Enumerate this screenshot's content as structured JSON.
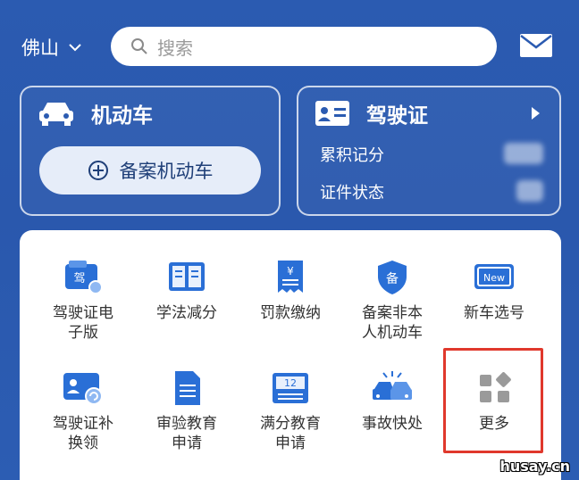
{
  "header": {
    "city": "佛山",
    "search_placeholder": "搜索"
  },
  "vehicle_card": {
    "title": "机动车",
    "register_button": "备案机动车"
  },
  "license_card": {
    "title": "驾驶证",
    "rows": [
      {
        "label": "累积记分"
      },
      {
        "label": "证件状态"
      }
    ]
  },
  "services": [
    {
      "label_line1": "驾驶证电",
      "label_line2": "子版",
      "icon": "e-license-icon"
    },
    {
      "label_line1": "学法减分",
      "label_line2": "",
      "icon": "book-icon"
    },
    {
      "label_line1": "罚款缴纳",
      "label_line2": "",
      "icon": "fine-receipt-icon"
    },
    {
      "label_line1": "备案非本",
      "label_line2": "人机动车",
      "icon": "shield-register-icon"
    },
    {
      "label_line1": "新车选号",
      "label_line2": "",
      "icon": "new-plate-icon",
      "badge": "New"
    },
    {
      "label_line1": "驾驶证补",
      "label_line2": "换领",
      "icon": "license-renew-icon"
    },
    {
      "label_line1": "审验教育",
      "label_line2": "申请",
      "icon": "document-icon"
    },
    {
      "label_line1": "满分教育",
      "label_line2": "申请",
      "icon": "calendar-icon",
      "badge": "12"
    },
    {
      "label_line1": "事故快处",
      "label_line2": "",
      "icon": "accident-icon"
    },
    {
      "label_line1": "更多",
      "label_line2": "",
      "icon": "more-grid-icon"
    }
  ],
  "watermark": "husay.cn",
  "colors": {
    "background": "#2b5bb1",
    "accent_blue": "#2a6fd6",
    "highlight_red": "#e0382c"
  }
}
